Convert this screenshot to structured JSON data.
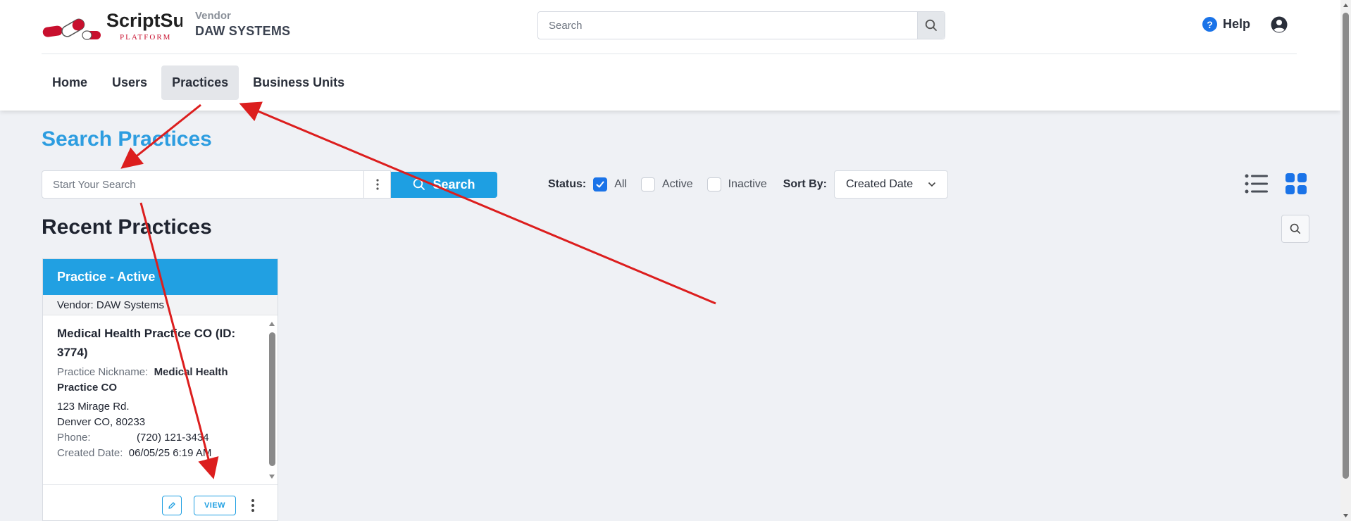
{
  "brand": {
    "logo_text": "ScriptSure",
    "logo_sub": "PLATFORM",
    "vendor_label": "Vendor",
    "vendor_name": "DAW SYSTEMS"
  },
  "header": {
    "search_placeholder": "Search",
    "help_label": "Help"
  },
  "nav": {
    "items": [
      {
        "label": "Home"
      },
      {
        "label": "Users"
      },
      {
        "label": "Practices"
      },
      {
        "label": "Business Units"
      }
    ],
    "active": "Practices"
  },
  "page": {
    "title": "Search Practices",
    "search_placeholder": "Start Your Search",
    "search_button": "Search",
    "status_label": "Status:",
    "status_options": [
      {
        "label": "All",
        "checked": true
      },
      {
        "label": "Active",
        "checked": false
      },
      {
        "label": "Inactive",
        "checked": false
      }
    ],
    "sort_label": "Sort By:",
    "sort_value": "Created Date",
    "recent_title": "Recent Practices"
  },
  "card": {
    "header": "Practice - Active",
    "vendor_line": "Vendor: DAW Systems",
    "name": "Medical Health Practice CO (ID: 3774)",
    "nickname_label": "Practice Nickname:",
    "nickname_value": "Medical Health Practice CO",
    "address_line1": "123 Mirage Rd.",
    "address_line2": "Denver CO, 80233",
    "phone_label": "Phone:",
    "phone_value": "(720) 121-3434",
    "created_label": "Created Date:",
    "created_value": "06/05/25 6:19 AM",
    "view_button": "VIEW"
  },
  "colors": {
    "accent": "#1e9fe2",
    "title_blue": "#2d9de0",
    "annotation_red": "#dc1e1e",
    "logo_red": "#d0021b"
  }
}
